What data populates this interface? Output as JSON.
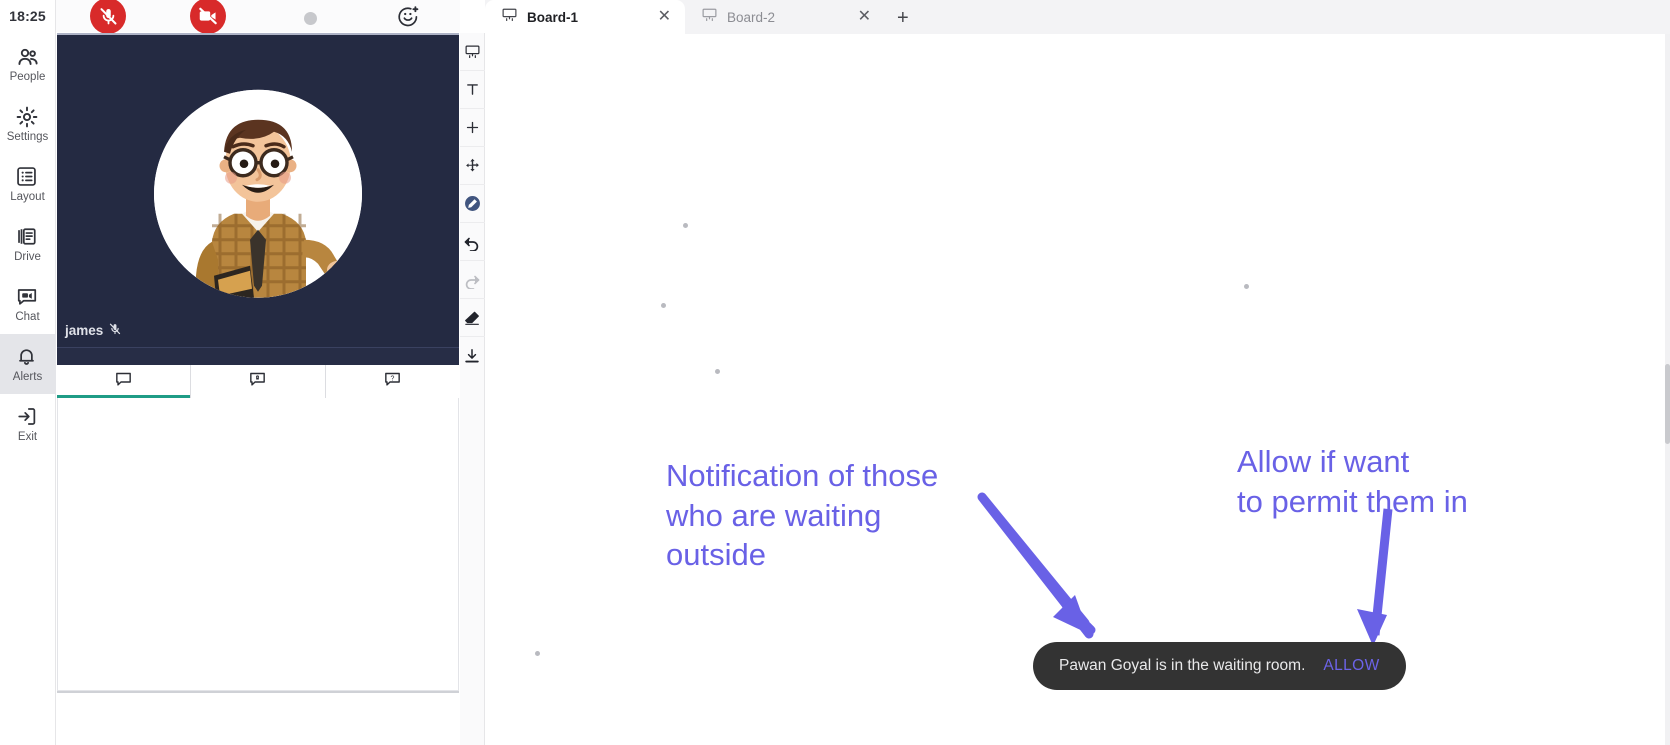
{
  "nav": {
    "clock": "18:25",
    "items": [
      {
        "label": "People",
        "icon": "people-icon"
      },
      {
        "label": "Settings",
        "icon": "gear-icon"
      },
      {
        "label": "Layout",
        "icon": "layout-icon"
      },
      {
        "label": "Drive",
        "icon": "drive-icon"
      },
      {
        "label": "Chat",
        "icon": "chat-icon"
      },
      {
        "label": "Alerts",
        "icon": "bell-icon"
      },
      {
        "label": "Exit",
        "icon": "exit-icon"
      }
    ],
    "active_label": "Alerts"
  },
  "panel": {
    "controls": {
      "mic": "mic-muted",
      "camera": "camera-off",
      "record": "record-dot",
      "reaction": "emoji-add"
    },
    "participant": {
      "name": "james",
      "muted_icon": "mic-muted-small"
    },
    "chat_tabs": [
      {
        "icon": "chat-bubble-icon",
        "active": true
      },
      {
        "icon": "private-chat-icon",
        "active": false
      },
      {
        "icon": "qa-question-icon",
        "active": false
      }
    ]
  },
  "toolbar": {
    "tools": [
      {
        "name": "whiteboard-tool",
        "state": "normal"
      },
      {
        "name": "text-tool",
        "state": "normal"
      },
      {
        "name": "add-tool",
        "state": "normal"
      },
      {
        "name": "move-tool",
        "state": "normal"
      },
      {
        "name": "pen-tool",
        "state": "selected"
      },
      {
        "name": "undo-tool",
        "state": "normal"
      },
      {
        "name": "redo-tool",
        "state": "disabled"
      },
      {
        "name": "eraser-tool",
        "state": "normal"
      },
      {
        "name": "download-tool",
        "state": "normal"
      }
    ]
  },
  "boards": {
    "tabs": [
      {
        "label": "Board-1",
        "active": true
      },
      {
        "label": "Board-2",
        "active": false
      }
    ],
    "add_label": "+"
  },
  "annotations": {
    "left": "Notification of those\nwho are waiting\noutside",
    "right": "Allow if want\nto permit them in"
  },
  "toast": {
    "message": "Pawan Goyal is in the waiting room.",
    "action": "ALLOW"
  },
  "colors": {
    "annotation": "#6961e6",
    "toast_bg": "#333333",
    "toast_action": "#6c63e8",
    "control_red": "#d82a2a",
    "video_bg": "#242a42",
    "tab_underline": "#1f9c86"
  }
}
